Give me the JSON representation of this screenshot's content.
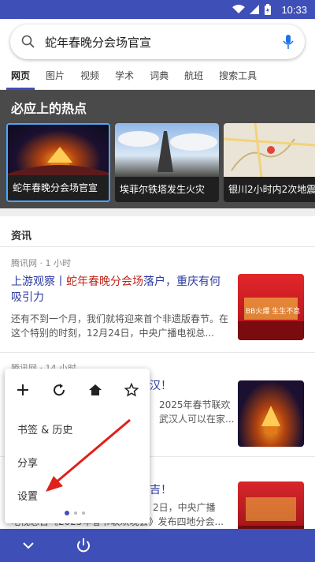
{
  "status_bar": {
    "time": "10:33"
  },
  "search": {
    "query": "蛇年春晚分会场官宣"
  },
  "tabs": [
    "网页",
    "图片",
    "视频",
    "学术",
    "词典",
    "航班",
    "搜索工具"
  ],
  "hot": {
    "title": "必应上的热点",
    "cards": [
      {
        "label": "蛇年春晚分会场官宣"
      },
      {
        "label": "埃菲尔铁塔发生火灾"
      },
      {
        "label": "银川2小时内2次地震"
      }
    ]
  },
  "news": {
    "heading": "资讯",
    "items": [
      {
        "source": "腾讯网 · 1 小时",
        "title_pre": "上游观察丨",
        "title_hl": "蛇年春晚分会场",
        "title_post": "落户，重庆有何吸引力",
        "desc": "还有不到一个月，我们就将迎来首个非遗版春节。在这个特别的时刻，12月24日，中央广播电视总..."
      },
      {
        "source": "腾讯网 · 14 小时",
        "title_tail": "汉！",
        "desc_lines": [
          "2025年春节联欢",
          "武汉人可以在家..."
        ]
      },
      {
        "title_tail": "吉！",
        "desc_lines": [
          "2日，中央广播",
          "电视总台《2025年春节联欢晚会》发布四地分会..."
        ]
      }
    ]
  },
  "menu": {
    "items": [
      "书签 & 历史",
      "分享",
      "设置"
    ]
  }
}
